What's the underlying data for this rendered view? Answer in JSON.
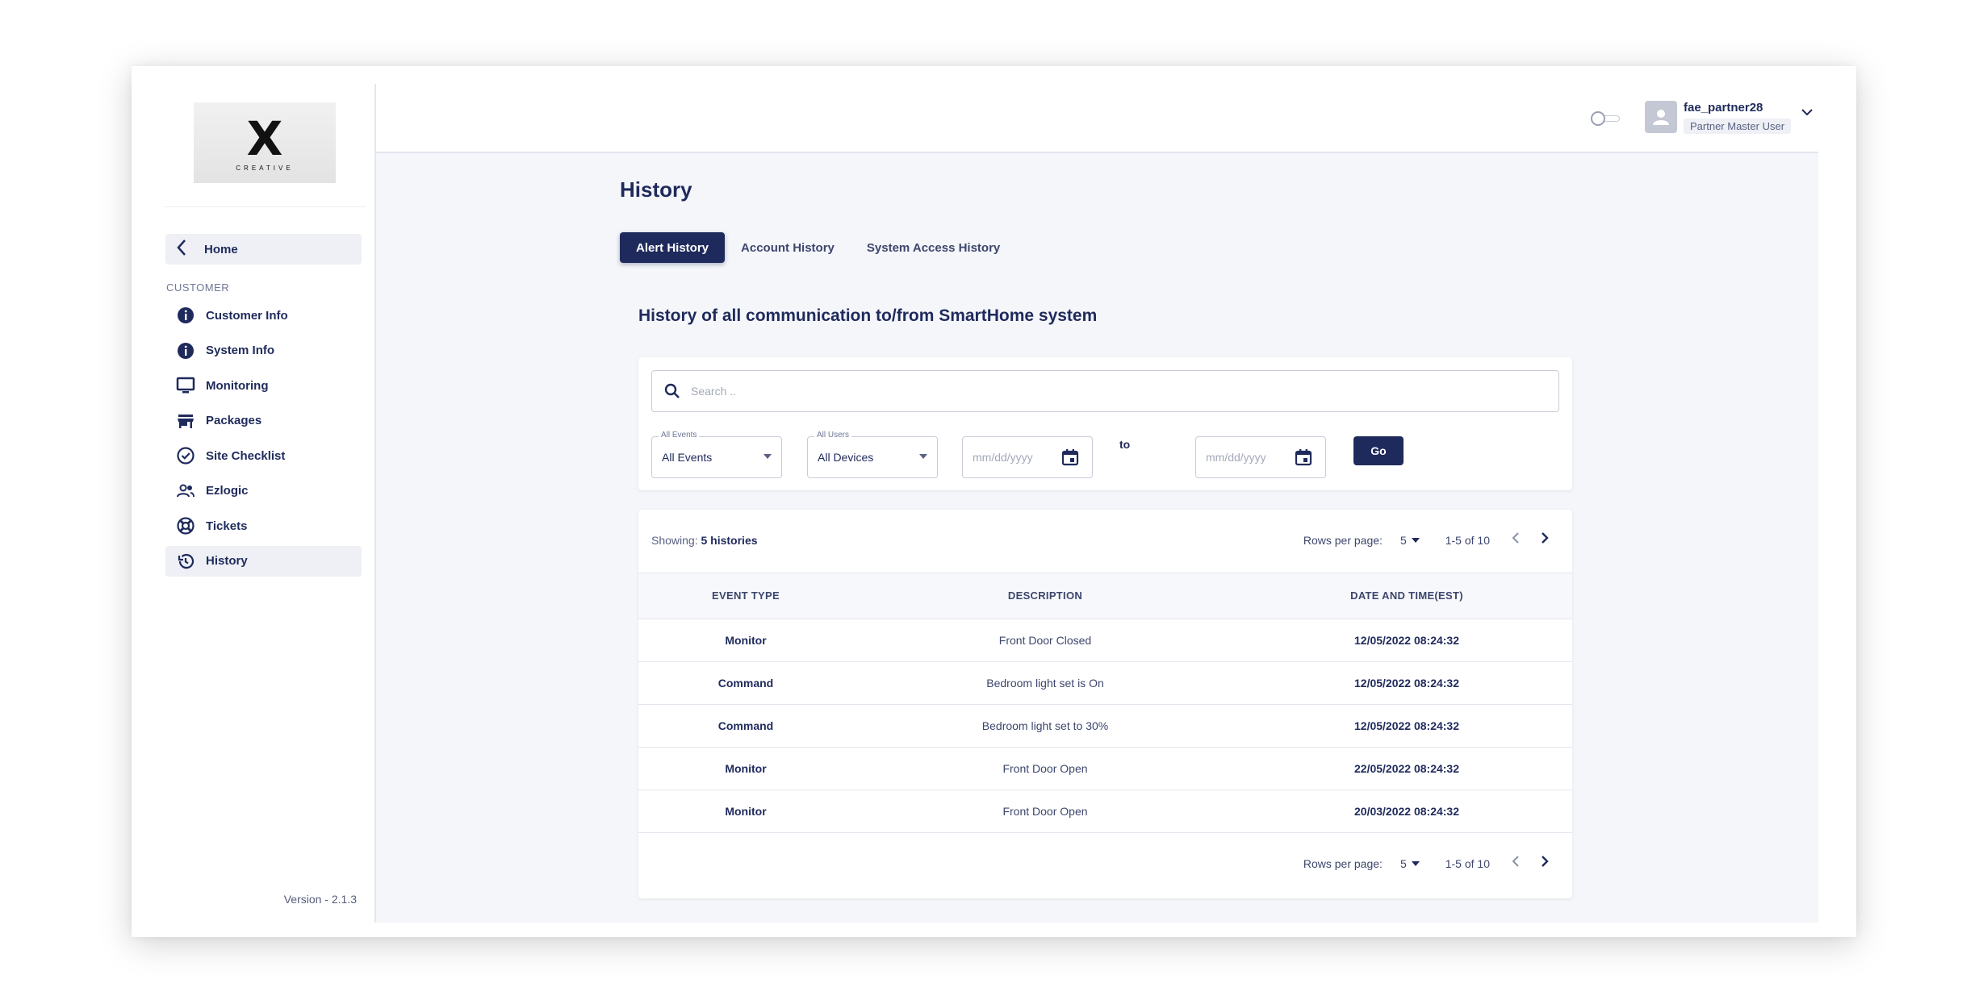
{
  "logo": {
    "mark": "X",
    "text": "CREATIVE"
  },
  "sidebar": {
    "home_label": "Home",
    "section_label": "CUSTOMER",
    "items": [
      {
        "label": "Customer Info",
        "icon": "info-icon"
      },
      {
        "label": "System Info",
        "icon": "info-icon"
      },
      {
        "label": "Monitoring",
        "icon": "monitor-icon"
      },
      {
        "label": "Packages",
        "icon": "store-icon"
      },
      {
        "label": "Site Checklist",
        "icon": "check-circle-icon"
      },
      {
        "label": "Ezlogic",
        "icon": "people-icon"
      },
      {
        "label": "Tickets",
        "icon": "lifebuoy-icon"
      },
      {
        "label": "History",
        "icon": "history-icon",
        "active": true
      }
    ],
    "version": "Version - 2.1.3"
  },
  "header": {
    "username": "fae_partner28",
    "role": "Partner Master User"
  },
  "main": {
    "title": "History",
    "tabs": [
      {
        "label": "Alert History",
        "active": true
      },
      {
        "label": "Account History"
      },
      {
        "label": "System Access History"
      }
    ],
    "subheading": "History of all communication to/from SmartHome system",
    "filters": {
      "search_placeholder": "Search ..",
      "events_label": "All Events",
      "events_value": "All Events",
      "users_label": "All Users",
      "users_value": "All Devices",
      "date_from_placeholder": "mm/dd/yyyy",
      "to_label": "to",
      "date_to_placeholder": "mm/dd/yyyy",
      "go_label": "Go"
    },
    "table": {
      "showing_label": "Showing:",
      "showing_value": "5 histories",
      "rows_per_page_label": "Rows per page:",
      "rows_per_page_value": "5",
      "range": "1-5 of 10",
      "columns": [
        "EVENT TYPE",
        "DESCRIPTION",
        "DATE AND TIME(EST)"
      ],
      "rows": [
        {
          "type": "Monitor",
          "description": "Front Door Closed",
          "datetime": "12/05/2022 08:24:32"
        },
        {
          "type": "Command",
          "description": "Bedroom light set is On",
          "datetime": "12/05/2022 08:24:32"
        },
        {
          "type": "Command",
          "description": "Bedroom light set to 30%",
          "datetime": "12/05/2022 08:24:32"
        },
        {
          "type": "Monitor",
          "description": "Front Door Open",
          "datetime": "22/05/2022 08:24:32"
        },
        {
          "type": "Monitor",
          "description": "Front Door Open",
          "datetime": "20/03/2022 08:24:32"
        }
      ]
    }
  },
  "colors": {
    "primary": "#1f2a5c",
    "background": "#f5f6fa"
  }
}
